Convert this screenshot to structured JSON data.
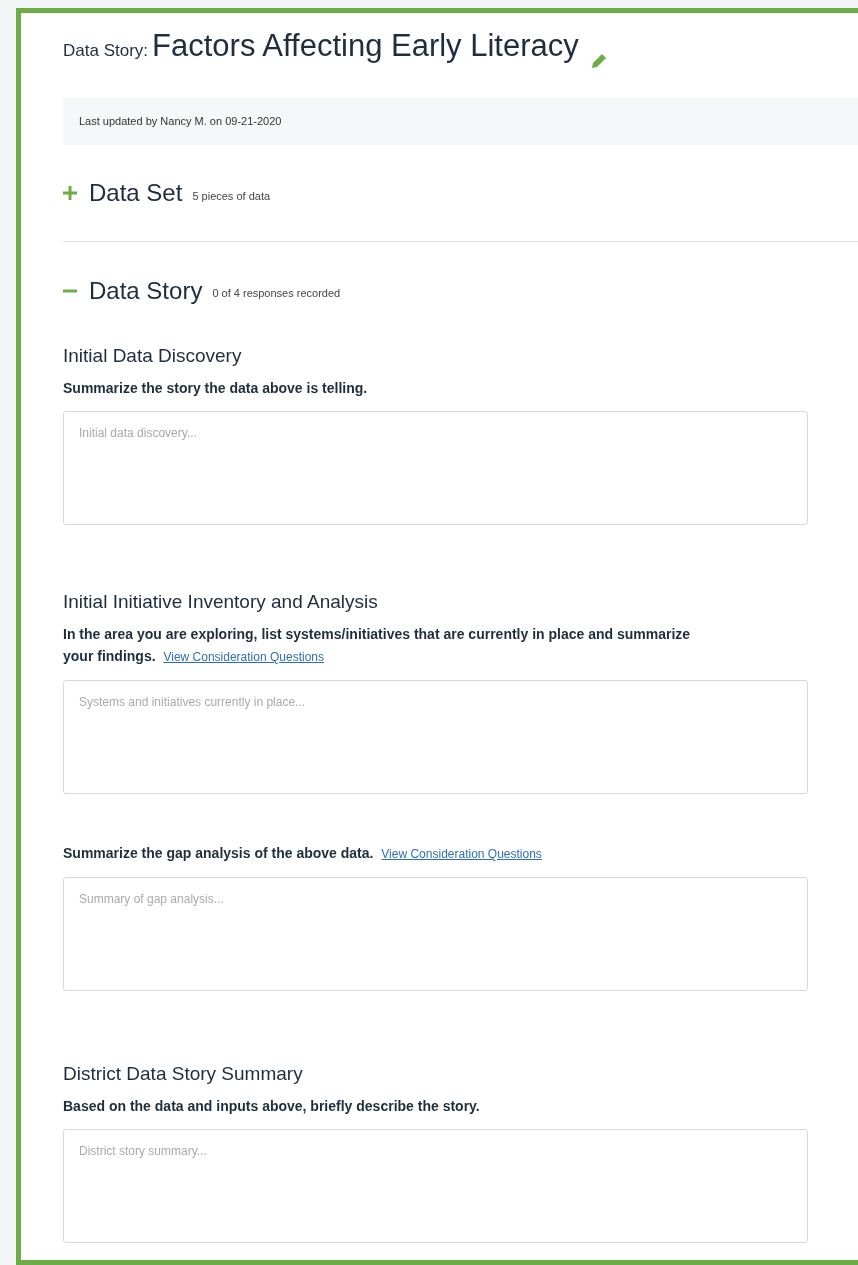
{
  "header": {
    "label": "Data Story:",
    "title": "Factors Affecting Early Literacy"
  },
  "last_updated": "Last updated by Nancy M. on 09-21-2020",
  "sections": [
    {
      "title": "Data Set",
      "count": "5 pieces of data",
      "expanded": false
    },
    {
      "title": "Data Story",
      "count": "0 of 4 responses recorded",
      "expanded": true
    }
  ],
  "questions": [
    {
      "heading": "Initial Data Discovery",
      "prompt": "Summarize the story the data above is telling.",
      "placeholder": "Initial data discovery..."
    },
    {
      "heading": "Initial Initiative Inventory and Analysis",
      "prompt": "In the area you are exploring, list systems/initiatives that are currently in place and summarize your findings.",
      "link": "View Consideration Questions",
      "placeholder": "Systems and initiatives currently in place..."
    },
    {
      "prompt": "Summarize the gap analysis of the above data.",
      "link": "View Consideration Questions",
      "placeholder": "Summary of gap analysis..."
    },
    {
      "heading": "District Data Story Summary",
      "prompt": "Based on the data and inputs above, briefly describe the story.",
      "placeholder": "District story summary..."
    }
  ]
}
